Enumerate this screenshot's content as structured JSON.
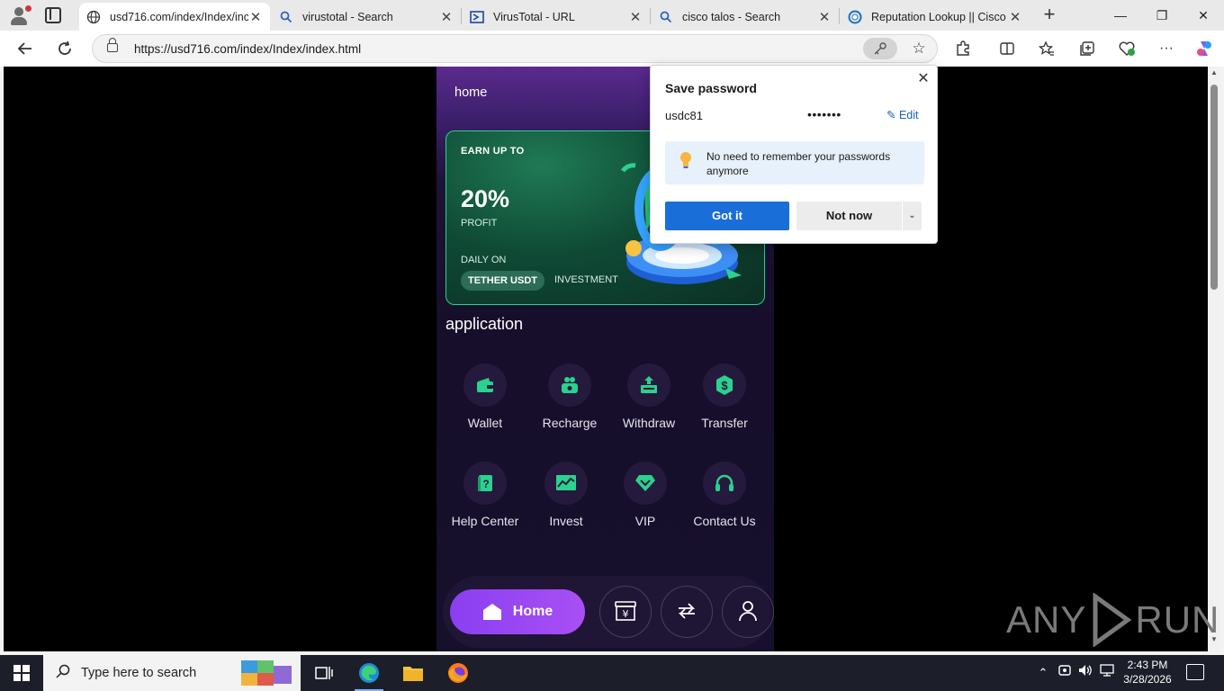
{
  "browser": {
    "tabs": [
      {
        "title": "usd716.com/index/Index/inc",
        "icon": "globe-icon",
        "active": true
      },
      {
        "title": "virustotal - Search",
        "icon": "search-icon",
        "active": false
      },
      {
        "title": "VirusTotal - URL",
        "icon": "virustotal-icon",
        "active": false
      },
      {
        "title": "cisco talos - Search",
        "icon": "search-icon",
        "active": false
      },
      {
        "title": "Reputation Lookup || Cisco T",
        "icon": "talos-icon",
        "active": false
      }
    ],
    "url": "https://usd716.com/index/Index/index.html"
  },
  "app": {
    "header_title": "home",
    "banner": {
      "earn_label": "EARN UP TO",
      "percent": "20%",
      "profit_label": "PROFIT",
      "daily_label": "DAILY ON",
      "pill_label": "TETHER USDT",
      "investment_label": "INVESTMENT"
    },
    "section_title": "application",
    "items": [
      {
        "label": "Wallet",
        "icon": "wallet-icon"
      },
      {
        "label": "Recharge",
        "icon": "recharge-icon"
      },
      {
        "label": "Withdraw",
        "icon": "withdraw-icon"
      },
      {
        "label": "Transfer",
        "icon": "transfer-icon"
      },
      {
        "label": "Help Center",
        "icon": "help-center-icon"
      },
      {
        "label": "Invest",
        "icon": "invest-icon"
      },
      {
        "label": "VIP",
        "icon": "vip-diamond-icon"
      },
      {
        "label": "Contact Us",
        "icon": "headset-icon"
      }
    ],
    "bottom_nav": {
      "home_label": "Home",
      "items": [
        "home-icon",
        "yen-bill-icon",
        "exchange-icon",
        "user-icon"
      ]
    }
  },
  "password_popup": {
    "title": "Save password",
    "username": "usdc81",
    "password_masked": "•••••••",
    "edit_label": "Edit",
    "tip": "No need to remember your passwords anymore",
    "primary_button": "Got it",
    "secondary_button": "Not now"
  },
  "watermark": {
    "left": "ANY",
    "right": "RUN"
  },
  "taskbar": {
    "search_placeholder": "Type here to search",
    "time": "2:43 PM",
    "date": "3/28/2026"
  },
  "colors": {
    "accent_green": "#2bd18e",
    "accent_purple": "#9a47f2",
    "edge_blue": "#1a6ed8"
  }
}
